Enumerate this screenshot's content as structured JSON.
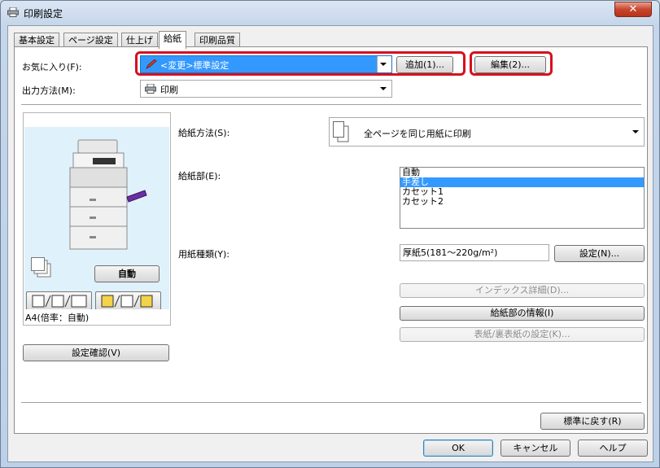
{
  "window": {
    "title": "印刷設定",
    "close_label": "✕"
  },
  "tabs": [
    {
      "label": "基本設定",
      "active": false
    },
    {
      "label": "ページ設定",
      "active": false
    },
    {
      "label": "仕上げ",
      "active": false
    },
    {
      "label": "給紙",
      "active": true
    },
    {
      "label": "印刷品質",
      "active": false
    }
  ],
  "favorites": {
    "label": "お気に入り(F):",
    "value": "<変更>標準設定",
    "add_label": "追加(1)...",
    "edit_label": "編集(2)..."
  },
  "output": {
    "label": "出力方法(M):",
    "value": "印刷"
  },
  "paper_source_mode": {
    "label": "給紙方法(S):",
    "value": "全ページを同じ用紙に印刷"
  },
  "paper_source": {
    "label": "給紙部(E):",
    "items": [
      {
        "label": "自動",
        "selected": false
      },
      {
        "label": "手差し",
        "selected": true
      },
      {
        "label": "カセット1",
        "selected": false
      },
      {
        "label": "カセット2",
        "selected": false
      }
    ]
  },
  "paper_type": {
    "label": "用紙種類(Y):",
    "value": "厚紙5(181～220g/m²)",
    "settings_label": "設定(N)..."
  },
  "buttons": {
    "index_detail": "インデックス詳細(D)...",
    "source_info": "給紙部の情報(I)",
    "cover_settings": "表紙/裏表紙の設定(K)...",
    "confirm_settings": "設定確認(V)",
    "restore_defaults": "標準に戻す(R)",
    "ok": "OK",
    "cancel": "キャンセル",
    "help": "ヘルプ"
  },
  "preview": {
    "auto_label": "自動",
    "status": "A4(倍率：自動)"
  },
  "colors": {
    "accent": "#3399ff",
    "highlight": "#d6101e"
  }
}
